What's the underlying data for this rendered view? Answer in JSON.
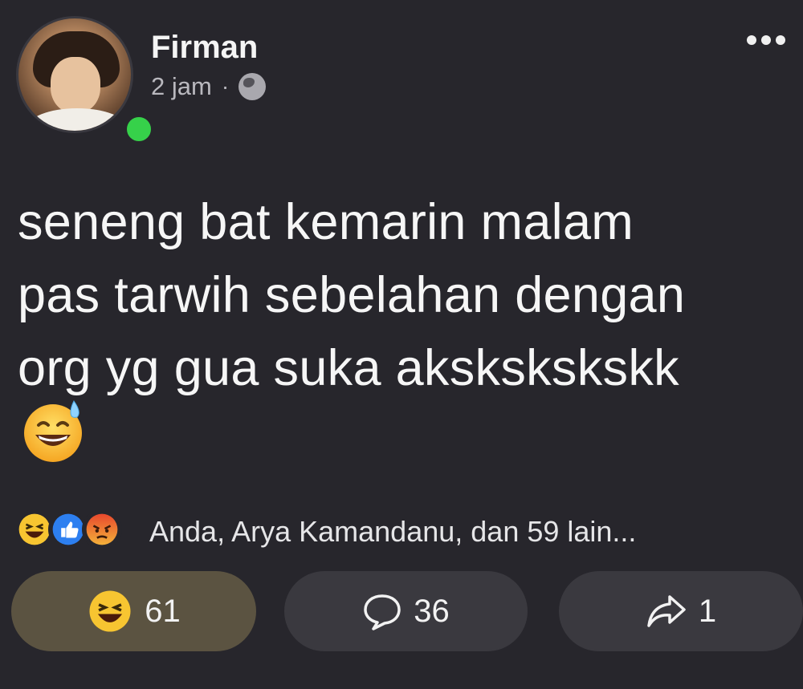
{
  "post": {
    "author": "Firman",
    "time": "2 jam",
    "separator": "·",
    "text_lines": [
      "seneng bat kemarin malam",
      "pas tarwih sebelahan dengan",
      "org yg gua suka akskskskskk"
    ],
    "trailing_emoji": "grinning-sweat-emoji"
  },
  "reactions": {
    "icons": [
      "haha-icon",
      "like-icon",
      "angry-icon"
    ],
    "summary": "Anda, Arya Kamandanu, dan 59 lain..."
  },
  "actions": {
    "react_count": "61",
    "comment_count": "36",
    "share_count": "1"
  },
  "colors": {
    "background": "#27262c",
    "online": "#36d14a",
    "react_active": "#5b5341",
    "button": "#3a393f"
  }
}
